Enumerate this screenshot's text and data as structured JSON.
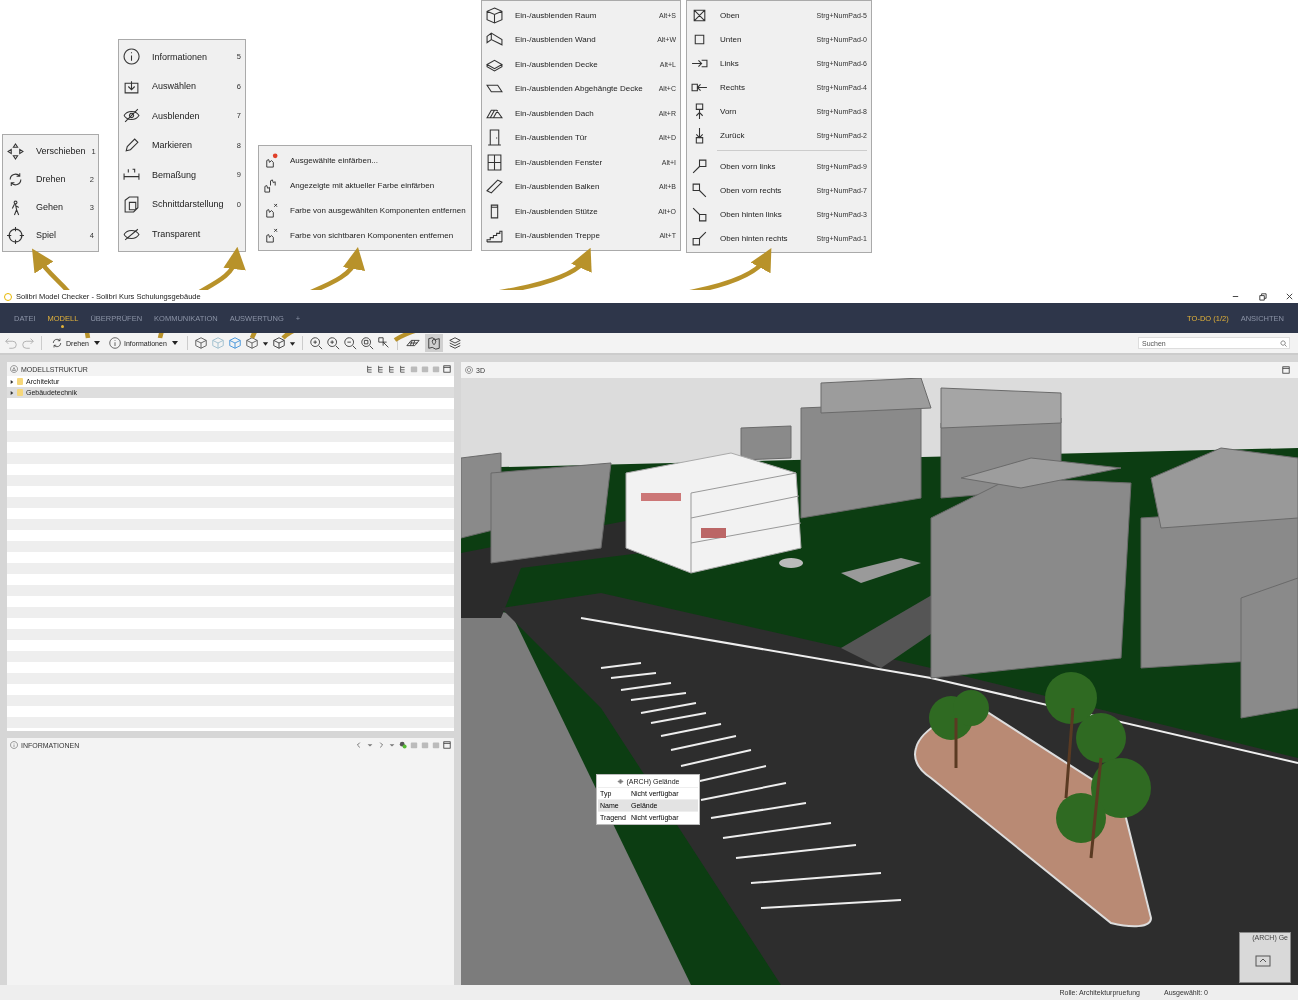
{
  "callout_menus": [
    {
      "sections": [
        [
          {
            "label": "Verschieben",
            "shortcut": "1"
          },
          {
            "label": "Drehen",
            "shortcut": "2"
          },
          {
            "label": "Gehen",
            "shortcut": "3"
          },
          {
            "label": "Spiel",
            "shortcut": "4"
          }
        ]
      ]
    },
    {
      "sections": [
        [
          {
            "label": "Informationen",
            "shortcut": "5"
          },
          {
            "label": "Auswählen",
            "shortcut": "6"
          },
          {
            "label": "Ausblenden",
            "shortcut": "7"
          },
          {
            "label": "Markieren",
            "shortcut": "8"
          },
          {
            "label": "Bemaßung",
            "shortcut": "9"
          },
          {
            "label": "Schnittdarstellung",
            "shortcut": "0"
          },
          {
            "label": "Transparent"
          }
        ]
      ]
    },
    {
      "sections": [
        [
          {
            "label": "Ausgewählte einfärben..."
          },
          {
            "label": "Angezeigte mit aktueller Farbe einfärben"
          },
          {
            "label": "Farbe von ausgewählten Komponenten entfernen"
          },
          {
            "label": "Farbe von sichtbaren Komponenten entfernen"
          }
        ]
      ]
    },
    {
      "sections": [
        [
          {
            "label": "Ein-/ausblenden Raum",
            "shortcut": "Alt+S"
          },
          {
            "label": "Ein-/ausblenden Wand",
            "shortcut": "Alt+W"
          },
          {
            "label": "Ein-/ausblenden Decke",
            "shortcut": "Alt+L"
          },
          {
            "label": "Ein-/ausblenden Abgehängte Decke",
            "shortcut": "Alt+C"
          },
          {
            "label": "Ein-/ausblenden Dach",
            "shortcut": "Alt+R"
          },
          {
            "label": "Ein-/ausblenden Tür",
            "shortcut": "Alt+D"
          },
          {
            "label": "Ein-/ausblenden Fenster",
            "shortcut": "Alt+I"
          },
          {
            "label": "Ein-/ausblenden Balken",
            "shortcut": "Alt+B"
          },
          {
            "label": "Ein-/ausblenden Stütze",
            "shortcut": "Alt+O"
          },
          {
            "label": "Ein-/ausblenden Treppe",
            "shortcut": "Alt+T"
          }
        ]
      ]
    },
    {
      "sections": [
        [
          {
            "label": "Oben",
            "shortcut": "Strg+NumPad-5"
          },
          {
            "label": "Unten",
            "shortcut": "Strg+NumPad-0"
          },
          {
            "label": "Links",
            "shortcut": "Strg+NumPad-6"
          },
          {
            "label": "Rechts",
            "shortcut": "Strg+NumPad-4"
          },
          {
            "label": "Vorn",
            "shortcut": "Strg+NumPad-8"
          },
          {
            "label": "Zurück",
            "shortcut": "Strg+NumPad-2"
          }
        ],
        [
          {
            "label": "Oben vorn links",
            "shortcut": "Strg+NumPad-9"
          },
          {
            "label": "Oben vorn rechts",
            "shortcut": "Strg+NumPad-7"
          },
          {
            "label": "Oben hinten links",
            "shortcut": "Strg+NumPad-3"
          },
          {
            "label": "Oben hinten rechts",
            "shortcut": "Strg+NumPad-1"
          }
        ]
      ]
    }
  ],
  "window": {
    "title": "Solibri Model Checker - Solibri Kurs Schulungsgebäude"
  },
  "tabs": [
    {
      "label": "DATEI",
      "selected": false
    },
    {
      "label": "MODELL",
      "selected": true
    },
    {
      "label": "ÜBERPRÜFEN",
      "selected": false
    },
    {
      "label": "KOMMUNIKATION",
      "selected": false
    },
    {
      "label": "AUSWERTUNG",
      "selected": false
    },
    {
      "label": "+",
      "selected": false
    }
  ],
  "right_tabs": [
    {
      "label": "TO-DO (1/2)",
      "selected": true
    },
    {
      "label": "ANSICHTEN",
      "selected": false
    }
  ],
  "toolbar": {
    "mode_button": "Drehen",
    "info_button": "Informationen",
    "view_toggles": [
      {
        "selected": false
      },
      {
        "selected": true
      },
      {
        "selected": false
      }
    ],
    "search": {
      "placeholder": "Suchen"
    }
  },
  "model_tree": {
    "title": "MODELLSTRUKTUR",
    "items": [
      {
        "label": "Architektur",
        "selected": false
      },
      {
        "label": "Gebäudetechnik",
        "selected": true
      }
    ]
  },
  "info_panel": {
    "title": "INFORMATIONEN"
  },
  "view_3d": {
    "title": "3D",
    "tooltip": {
      "title": "(ARCH) Gelände",
      "rows": [
        {
          "key": "Typ",
          "value": "Nicht verfügbar",
          "selected": false
        },
        {
          "key": "Name",
          "value": "Gelände",
          "selected": true
        },
        {
          "key": "Tragend",
          "value": "Nicht verfügbar",
          "selected": false
        }
      ]
    },
    "minimap_label": "(ARCH) Ge"
  },
  "status_bar": {
    "role": "Rolle: Architekturpruefung",
    "selected": "Ausgewählt: 0"
  }
}
